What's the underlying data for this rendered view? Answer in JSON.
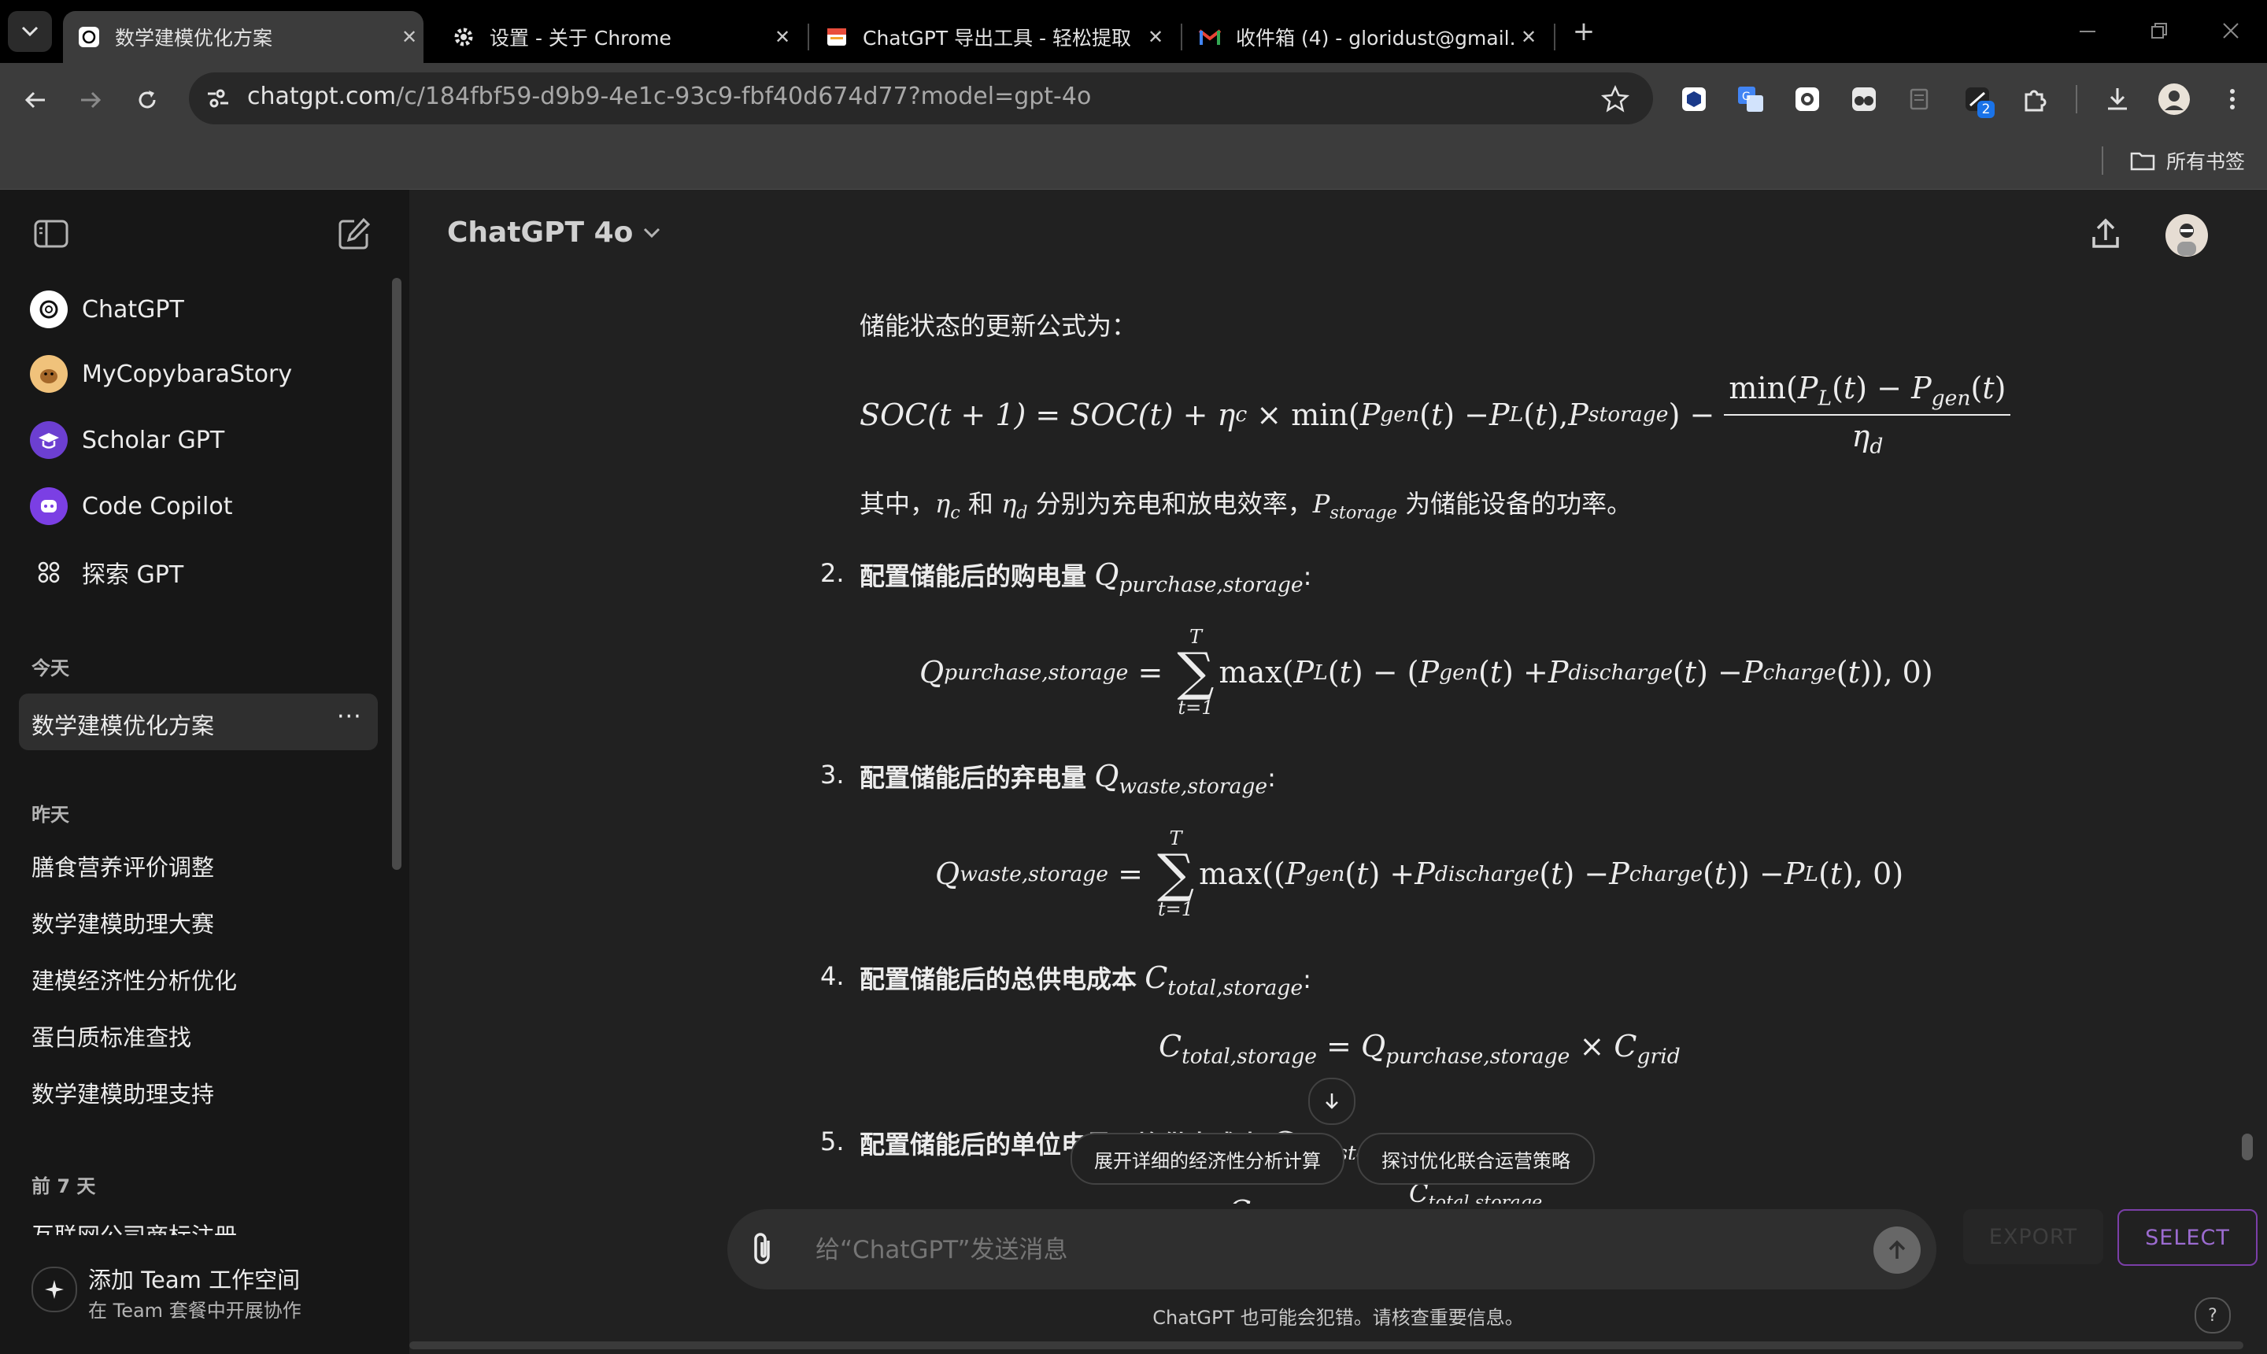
{
  "browser": {
    "tabs": [
      {
        "title": "数学建模优化方案",
        "active": true
      },
      {
        "title": "设置 - 关于 Chrome",
        "active": false
      },
      {
        "title": "ChatGPT 导出工具 - 轻松提取",
        "active": false
      },
      {
        "title": "收件箱 (4) - gloridust@gmail.",
        "active": false
      }
    ],
    "new_tab_icon": "plus-icon",
    "url_domain": "chatgpt.com",
    "url_path": "/c/184fbf59-d9b9-4e1c-93c9-fbf40d674d77?model=gpt-4o",
    "extension_badge": "2",
    "bookmarks_folder": "所有书签"
  },
  "sidebar": {
    "gpts": [
      {
        "label": "ChatGPT",
        "icon": "openai-logo-icon"
      },
      {
        "label": "MyCopybaraStory",
        "icon": "capybara-avatar-icon"
      },
      {
        "label": "Scholar GPT",
        "icon": "scholar-gpt-icon"
      },
      {
        "label": "Code Copilot",
        "icon": "code-copilot-icon"
      },
      {
        "label": "探索 GPT",
        "icon": "grid-icon"
      }
    ],
    "today_label": "今天",
    "today": [
      {
        "label": "数学建模优化方案"
      }
    ],
    "yesterday_label": "昨天",
    "yesterday": [
      {
        "label": "膳食营养评价调整"
      },
      {
        "label": "数学建模助理大赛"
      },
      {
        "label": "建模经济性分析优化"
      },
      {
        "label": "蛋白质标准查找"
      },
      {
        "label": "数学建模助理支持"
      }
    ],
    "week_label": "前 7 天",
    "week": [
      {
        "label": "互联网公司商标注册"
      }
    ],
    "team_title": "添加 Team 工作空间",
    "team_subtitle": "在 Team 套餐中开展协作"
  },
  "header": {
    "model": "ChatGPT 4o"
  },
  "message": {
    "intro": "储能状态的更新公式为：",
    "soc_lhs": "SOC(t + 1) = SOC(t) + η",
    "where_prefix": "其中，",
    "where_and": "和",
    "where_mid": "分别为充电和放电效率，",
    "where_suffix": "为储能设备的功率。",
    "items": [
      {
        "num": "2.",
        "label": "配置储能后的购电量"
      },
      {
        "num": "3.",
        "label": "配置储能后的弃电量"
      },
      {
        "num": "4.",
        "label": "配置储能后的总供电成本"
      },
      {
        "num": "5.",
        "label": "配置储能后的单位电量平均供电成本"
      }
    ]
  },
  "suggestions": [
    "展开详细的经济性分析计算",
    "探讨优化联合运营策略"
  ],
  "composer": {
    "placeholder": "给“ChatGPT”发送消息"
  },
  "export_label": "EXPORT",
  "select_label": "SELECT",
  "disclaimer": "ChatGPT 也可能会犯错。请核查重要信息。",
  "help_label": "?"
}
